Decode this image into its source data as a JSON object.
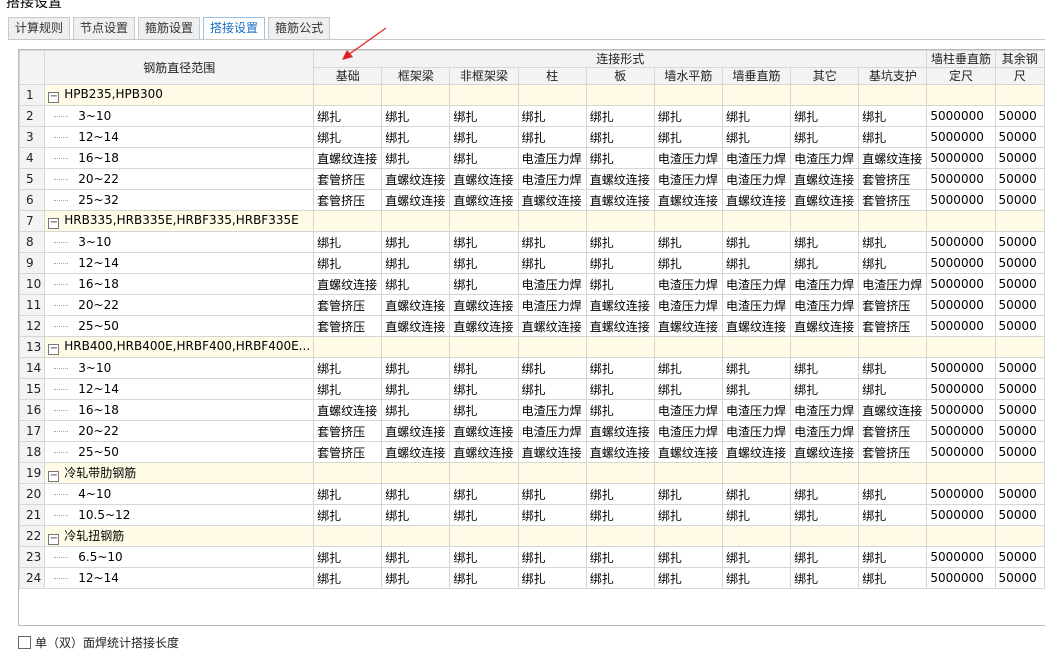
{
  "window": {
    "title_fragment": "搭接设置"
  },
  "tabs": [
    {
      "label": "计算规则",
      "active": false
    },
    {
      "label": "节点设置",
      "active": false
    },
    {
      "label": "箍筋设置",
      "active": false
    },
    {
      "label": "搭接设置",
      "active": true
    },
    {
      "label": "箍筋公式",
      "active": false
    }
  ],
  "table": {
    "header": {
      "diameter_range": "钢筋直径范围",
      "connection_form": "连接形式",
      "wall_col_vertical_line1": "墙柱垂直筋",
      "wall_col_vertical_line2": "定尺",
      "other_line1": "其余钢",
      "other_line2": "尺",
      "columns": [
        "基础",
        "框架梁",
        "非框架梁",
        "柱",
        "板",
        "墙水平筋",
        "墙垂直筋",
        "其它",
        "基坑支护"
      ]
    },
    "rows": [
      {
        "num": "1",
        "type": "group",
        "label": "HPB235,HPB300"
      },
      {
        "num": "2",
        "type": "item",
        "label": "3~10",
        "cells": [
          "绑扎",
          "绑扎",
          "绑扎",
          "绑扎",
          "绑扎",
          "绑扎",
          "绑扎",
          "绑扎",
          "绑扎"
        ],
        "fixed": "5000000",
        "other": "50000"
      },
      {
        "num": "3",
        "type": "item",
        "label": "12~14",
        "cells": [
          "绑扎",
          "绑扎",
          "绑扎",
          "绑扎",
          "绑扎",
          "绑扎",
          "绑扎",
          "绑扎",
          "绑扎"
        ],
        "fixed": "5000000",
        "other": "50000"
      },
      {
        "num": "4",
        "type": "item",
        "label": "16~18",
        "cells": [
          "直螺纹连接",
          "绑扎",
          "绑扎",
          "电渣压力焊",
          "绑扎",
          "电渣压力焊",
          "电渣压力焊",
          "电渣压力焊",
          "直螺纹连接"
        ],
        "fixed": "5000000",
        "other": "50000"
      },
      {
        "num": "5",
        "type": "item",
        "label": "20~22",
        "cells": [
          "套管挤压",
          "直螺纹连接",
          "直螺纹连接",
          "电渣压力焊",
          "直螺纹连接",
          "电渣压力焊",
          "电渣压力焊",
          "直螺纹连接",
          "套管挤压"
        ],
        "fixed": "5000000",
        "other": "50000"
      },
      {
        "num": "6",
        "type": "item",
        "label": "25~32",
        "cells": [
          "套管挤压",
          "直螺纹连接",
          "直螺纹连接",
          "直螺纹连接",
          "直螺纹连接",
          "直螺纹连接",
          "直螺纹连接",
          "直螺纹连接",
          "套管挤压"
        ],
        "fixed": "5000000",
        "other": "50000"
      },
      {
        "num": "7",
        "type": "group",
        "label": "HRB335,HRB335E,HRBF335,HRBF335E"
      },
      {
        "num": "8",
        "type": "item",
        "label": "3~10",
        "cells": [
          "绑扎",
          "绑扎",
          "绑扎",
          "绑扎",
          "绑扎",
          "绑扎",
          "绑扎",
          "绑扎",
          "绑扎"
        ],
        "fixed": "5000000",
        "other": "50000"
      },
      {
        "num": "9",
        "type": "item",
        "label": "12~14",
        "cells": [
          "绑扎",
          "绑扎",
          "绑扎",
          "绑扎",
          "绑扎",
          "绑扎",
          "绑扎",
          "绑扎",
          "绑扎"
        ],
        "fixed": "5000000",
        "other": "50000"
      },
      {
        "num": "10",
        "type": "item",
        "label": "16~18",
        "cells": [
          "直螺纹连接",
          "绑扎",
          "绑扎",
          "电渣压力焊",
          "绑扎",
          "电渣压力焊",
          "电渣压力焊",
          "电渣压力焊",
          "电渣压力焊"
        ],
        "fixed": "5000000",
        "other": "50000"
      },
      {
        "num": "11",
        "type": "item",
        "label": "20~22",
        "cells": [
          "套管挤压",
          "直螺纹连接",
          "直螺纹连接",
          "电渣压力焊",
          "直螺纹连接",
          "电渣压力焊",
          "电渣压力焊",
          "电渣压力焊",
          "套管挤压"
        ],
        "fixed": "5000000",
        "other": "50000"
      },
      {
        "num": "12",
        "type": "item",
        "label": "25~50",
        "cells": [
          "套管挤压",
          "直螺纹连接",
          "直螺纹连接",
          "直螺纹连接",
          "直螺纹连接",
          "直螺纹连接",
          "直螺纹连接",
          "直螺纹连接",
          "套管挤压"
        ],
        "fixed": "5000000",
        "other": "50000"
      },
      {
        "num": "13",
        "type": "group",
        "label": "HRB400,HRB400E,HRBF400,HRBF400E..."
      },
      {
        "num": "14",
        "type": "item",
        "label": "3~10",
        "cells": [
          "绑扎",
          "绑扎",
          "绑扎",
          "绑扎",
          "绑扎",
          "绑扎",
          "绑扎",
          "绑扎",
          "绑扎"
        ],
        "fixed": "5000000",
        "other": "50000"
      },
      {
        "num": "15",
        "type": "item",
        "label": "12~14",
        "cells": [
          "绑扎",
          "绑扎",
          "绑扎",
          "绑扎",
          "绑扎",
          "绑扎",
          "绑扎",
          "绑扎",
          "绑扎"
        ],
        "fixed": "5000000",
        "other": "50000"
      },
      {
        "num": "16",
        "type": "item",
        "label": "16~18",
        "cells": [
          "直螺纹连接",
          "绑扎",
          "绑扎",
          "电渣压力焊",
          "绑扎",
          "电渣压力焊",
          "电渣压力焊",
          "电渣压力焊",
          "直螺纹连接"
        ],
        "fixed": "5000000",
        "other": "50000"
      },
      {
        "num": "17",
        "type": "item",
        "label": "20~22",
        "cells": [
          "套管挤压",
          "直螺纹连接",
          "直螺纹连接",
          "电渣压力焊",
          "直螺纹连接",
          "电渣压力焊",
          "电渣压力焊",
          "电渣压力焊",
          "套管挤压"
        ],
        "fixed": "5000000",
        "other": "50000"
      },
      {
        "num": "18",
        "type": "item",
        "label": "25~50",
        "cells": [
          "套管挤压",
          "直螺纹连接",
          "直螺纹连接",
          "直螺纹连接",
          "直螺纹连接",
          "直螺纹连接",
          "直螺纹连接",
          "直螺纹连接",
          "套管挤压"
        ],
        "fixed": "5000000",
        "other": "50000"
      },
      {
        "num": "19",
        "type": "group",
        "label": "冷轧带肋钢筋"
      },
      {
        "num": "20",
        "type": "item",
        "label": "4~10",
        "cells": [
          "绑扎",
          "绑扎",
          "绑扎",
          "绑扎",
          "绑扎",
          "绑扎",
          "绑扎",
          "绑扎",
          "绑扎"
        ],
        "fixed": "5000000",
        "other": "50000"
      },
      {
        "num": "21",
        "type": "item",
        "label": "10.5~12",
        "cells": [
          "绑扎",
          "绑扎",
          "绑扎",
          "绑扎",
          "绑扎",
          "绑扎",
          "绑扎",
          "绑扎",
          "绑扎"
        ],
        "fixed": "5000000",
        "other": "50000"
      },
      {
        "num": "22",
        "type": "group",
        "label": "冷轧扭钢筋"
      },
      {
        "num": "23",
        "type": "item",
        "label": "6.5~10",
        "cells": [
          "绑扎",
          "绑扎",
          "绑扎",
          "绑扎",
          "绑扎",
          "绑扎",
          "绑扎",
          "绑扎",
          "绑扎"
        ],
        "fixed": "5000000",
        "other": "50000"
      },
      {
        "num": "24",
        "type": "item",
        "label": "12~14",
        "cells": [
          "绑扎",
          "绑扎",
          "绑扎",
          "绑扎",
          "绑扎",
          "绑扎",
          "绑扎",
          "绑扎",
          "绑扎"
        ],
        "fixed": "5000000",
        "other": "50000"
      }
    ]
  },
  "footer": {
    "checkbox_label": "单（双）面焊统计搭接长度",
    "checked": false
  },
  "colors": {
    "group_row_bg": "#fffbe6",
    "active_tab": "#1a6fc4",
    "annotation_arrow": "#e02020"
  },
  "icons": {
    "group_toggle": "collapse-minus-icon",
    "annotation": "red-arrow-icon"
  }
}
